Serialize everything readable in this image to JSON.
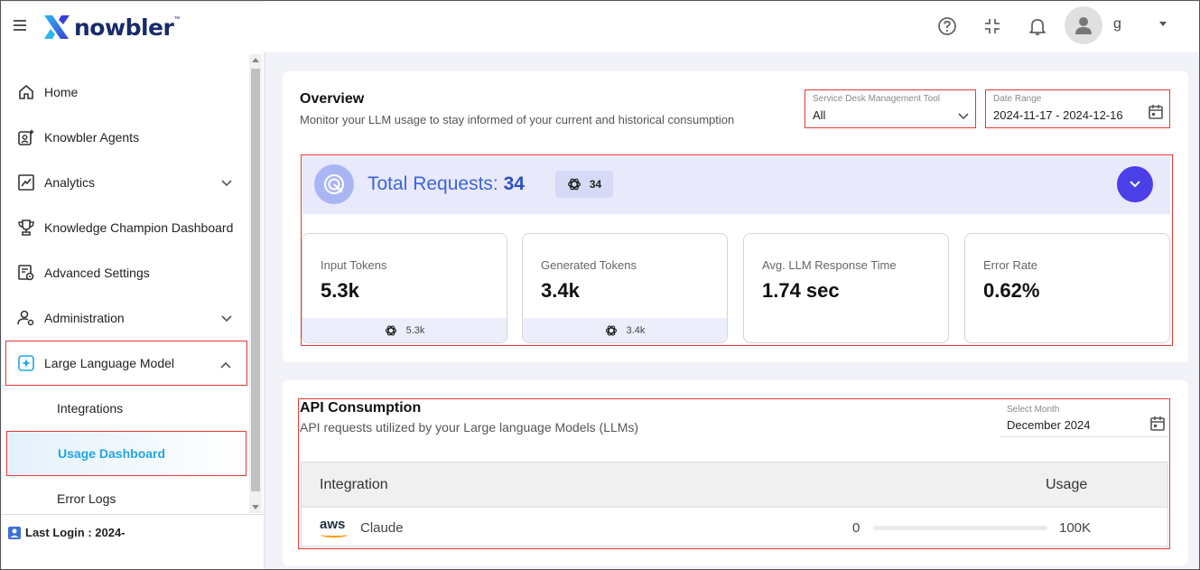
{
  "brand": {
    "name": "nowbler",
    "tm": "™"
  },
  "sidebar": {
    "items": [
      {
        "label": "Home"
      },
      {
        "label": "Knowbler Agents"
      },
      {
        "label": "Analytics"
      },
      {
        "label": "Knowledge Champion Dashboard"
      },
      {
        "label": "Advanced Settings"
      },
      {
        "label": "Administration"
      },
      {
        "label": "Large Language Model"
      }
    ],
    "sub_items": [
      {
        "label": "Integrations"
      },
      {
        "label": "Usage Dashboard"
      },
      {
        "label": "Error Logs"
      }
    ],
    "last_login": "Last Login : 2024-"
  },
  "topbar": {
    "user_name": "g"
  },
  "overview": {
    "title": "Overview",
    "subtitle": "Monitor your LLM usage to stay informed of your current and historical consumption",
    "tool_field": {
      "label": "Service Desk Management Tool",
      "value": "All"
    },
    "date_field": {
      "label": "Date Range",
      "value": "2024-11-17 - 2024-12-16"
    },
    "total_requests": {
      "label": "Total Requests:",
      "value": "34",
      "chip_value": "34"
    },
    "metrics": [
      {
        "label": "Input Tokens",
        "value": "5.3k",
        "foot": "5.3k"
      },
      {
        "label": "Generated Tokens",
        "value": "3.4k",
        "foot": "3.4k"
      },
      {
        "label": "Avg. LLM Response Time",
        "value": "1.74 sec"
      },
      {
        "label": "Error Rate",
        "value": "0.62%"
      }
    ]
  },
  "api": {
    "title": "API Consumption",
    "subtitle": "API requests utilized by your Large language Models (LLMs)",
    "month_field": {
      "label": "Select Month",
      "value": "December 2024"
    },
    "table": {
      "headers": [
        "Integration",
        "Usage"
      ],
      "rows": [
        {
          "provider": "aws",
          "name": "Claude",
          "min": "0",
          "max": "100K",
          "usage_fraction": 0
        }
      ]
    }
  },
  "colors": {
    "accent": "#4a3fe8",
    "highlight": "#e53935",
    "active": "#1fa6e0"
  }
}
